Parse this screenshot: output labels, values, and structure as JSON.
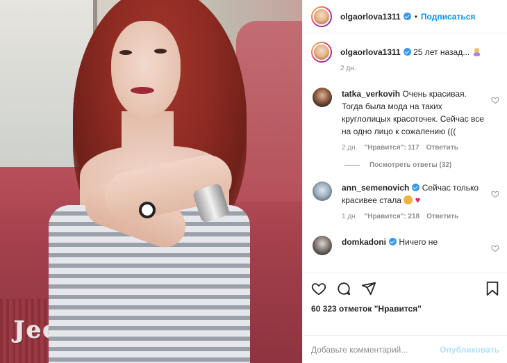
{
  "post": {
    "photo_label": "Jeep",
    "author": {
      "username": "olgaorlova1311",
      "verified": true
    },
    "follow_label": "Подписаться",
    "separator": "•",
    "caption": {
      "text": "25 лет назад...",
      "emoji": "woman-shrugging",
      "time": "2 дн."
    },
    "comments": [
      {
        "username": "tatka_verkovih",
        "verified": false,
        "text": "Очень красивая. Тогда была мода на таких круглолицых красоточек. Сейчас все на одно лицо к сожалению (((",
        "time": "2 дн.",
        "likes": "\"Нравится\": 117",
        "reply_label": "Ответить",
        "replies_label": "Посмотреть ответы (32)"
      },
      {
        "username": "ann_semenovich",
        "verified": true,
        "text": "Сейчас только красивее стала",
        "emoji": [
          "smiling-face",
          "red-heart"
        ],
        "time": "1 дн.",
        "likes": "\"Нравится\": 218",
        "reply_label": "Ответить"
      },
      {
        "username": "domkadoni",
        "verified": true,
        "text": "Ничего не"
      }
    ],
    "likes_count": "60 323 отметок \"Нравится\"",
    "comment_input": {
      "placeholder": "Добавьте комментарий...",
      "value": ""
    },
    "publish_label": "Опубликовать",
    "icons": {
      "like": "heart-icon",
      "comment": "comment-icon",
      "share": "share-icon",
      "save": "bookmark-icon"
    },
    "colors": {
      "link_blue": "#0095f6",
      "verified_blue": "#3897f0",
      "publish_disabled": "#b2dffc",
      "muted": "#8e8e8e",
      "text": "#262626",
      "heart_red": "#e0245e"
    }
  }
}
